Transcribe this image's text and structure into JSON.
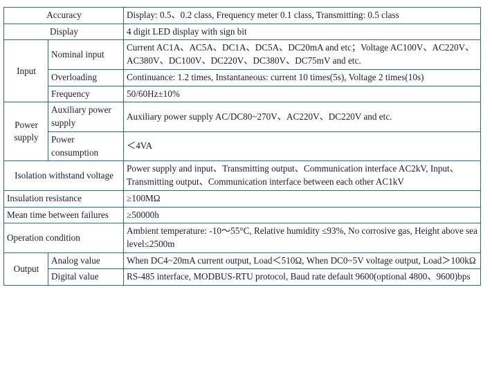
{
  "table": {
    "border_color": "#2b62a8",
    "text_color": "#1c1c30",
    "background": "#ffffff",
    "columns": 3,
    "rows": [
      {
        "kind": "span2-center",
        "label": "Accuracy",
        "value": "Display: 0.5、0.2 class, Frequency meter 0.1 class, Transmitting: 0.5 class"
      },
      {
        "kind": "span2-center",
        "label": "Display",
        "value": "4 digit LED display with sign bit"
      },
      {
        "kind": "group-first",
        "group": "Input",
        "group_rowspan": 3,
        "label": "Nominal input",
        "value": "Current AC1A、AC5A、DC1A、DC5A、DC20mA and etc；Voltage AC100V、AC220V、AC380V、DC100V、DC220V、DC380V、DC75mV and etc."
      },
      {
        "kind": "group-cont",
        "label": "Overloading",
        "value": "Continuance: 1.2 times, Instantaneous: current 10 times(5s), Voltage 2 times(10s)"
      },
      {
        "kind": "group-cont",
        "label": "Frequency",
        "value": "50/60Hz±10%"
      },
      {
        "kind": "group-first",
        "group": "Power supply",
        "group_rowspan": 2,
        "label": "Auxiliary power supply",
        "value": "Auxiliary power supply AC/DC80~270V、AC220V、DC220V and etc."
      },
      {
        "kind": "group-cont",
        "label": "Power consumption",
        "value": "＜4VA"
      },
      {
        "kind": "span2-center",
        "label": "Isolation withstand voltage",
        "value": "Power supply and input、Transmitting output、Communication interface AC2kV, Input、Transmitting output、Communication interface between each other AC1kV"
      },
      {
        "kind": "span2-left",
        "label": "Insulation resistance",
        "value": "≥100MΩ"
      },
      {
        "kind": "span2-left",
        "label": "Mean time between failures",
        "value": "≥50000h"
      },
      {
        "kind": "span2-left",
        "label": "Operation condition",
        "value": "Ambient temperature: -10～55°C, Relative humidity ≤93%, No corrosive gas, Height above sea level≤2500m"
      },
      {
        "kind": "group-first",
        "group": "Output",
        "group_rowspan": 2,
        "label": "Analog value",
        "value": "When DC4~20mA current output, Load＜510Ω, When DC0~5V voltage output, Load＞100kΩ"
      },
      {
        "kind": "group-cont",
        "label": "Digital value",
        "value": "RS-485 interface, MODBUS-RTU protocol, Baud rate default 9600(optional 4800、9600)bps"
      }
    ]
  }
}
